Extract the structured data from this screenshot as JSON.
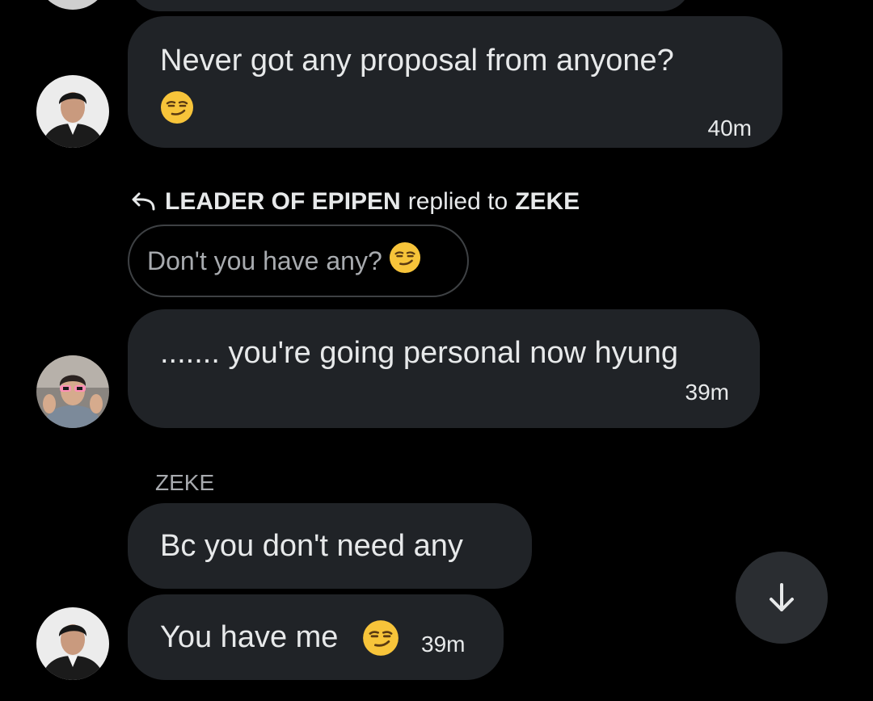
{
  "messages": [
    {
      "text": "Never got any proposal from anyone?",
      "emoji": "smirk-emoji",
      "time": "40m"
    },
    {
      "text": "....... you're going personal now hyung",
      "time": "39m"
    },
    {
      "text": "Bc you don't need any"
    },
    {
      "text": "You have me",
      "emoji": "smirk-emoji",
      "time": "39m"
    }
  ],
  "reply": {
    "icon": "reply-arrow-icon",
    "sender": "LEADER OF EPIPEN",
    "verb": "replied to",
    "target": "ZEKE",
    "quoted_text": "Don't you have any?",
    "quoted_emoji": "smirk-emoji"
  },
  "sender_label": "ZEKE",
  "scroll_button_icon": "arrow-down-icon",
  "colors": {
    "background": "#000000",
    "bubble": "#202327",
    "text": "#e7e9ea",
    "muted_text": "#a8abaf",
    "emoji": "#f7c43a"
  }
}
